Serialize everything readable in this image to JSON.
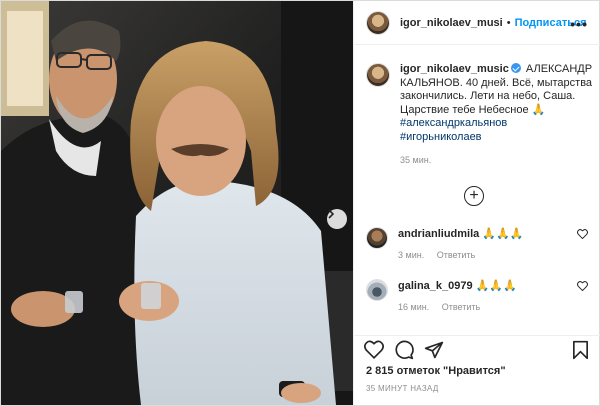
{
  "header": {
    "username": "igor_nikolaev_musi",
    "separator": "•",
    "follow_label": "Подписаться",
    "more_label": "•••"
  },
  "caption": {
    "username": "igor_nikolaev_music",
    "text": "АЛЕКСАНДР КАЛЬЯНОВ. 40 дней. Всё, мытарства закончились. Лети на небо, Саша. Царствие тебе Небесное",
    "emoji": "🙏",
    "hashtags": [
      "#александркальянов",
      "#игорьниколаев"
    ],
    "time": "35 мин."
  },
  "comments": [
    {
      "username": "andrianliudmila",
      "text": "🙏🙏🙏",
      "time": "3 мин.",
      "reply_label": "Ответить"
    },
    {
      "username": "galina_k_0979",
      "text": "🙏🙏🙏",
      "time": "16 мин.",
      "reply_label": "Ответить"
    }
  ],
  "stats": {
    "likes_text": "2 815 отметок \"Нравится\"",
    "posted_text": "35 МИНУТ НАЗАД"
  },
  "icons": {
    "like": "heart-icon",
    "comment": "comment-icon",
    "share": "share-icon",
    "save": "bookmark-icon",
    "load_more": "plus-circle-icon",
    "next": "chevron-right-icon"
  },
  "colors": {
    "accent": "#0095f6",
    "hashtag": "#00376b",
    "muted": "#8e8e8e"
  }
}
